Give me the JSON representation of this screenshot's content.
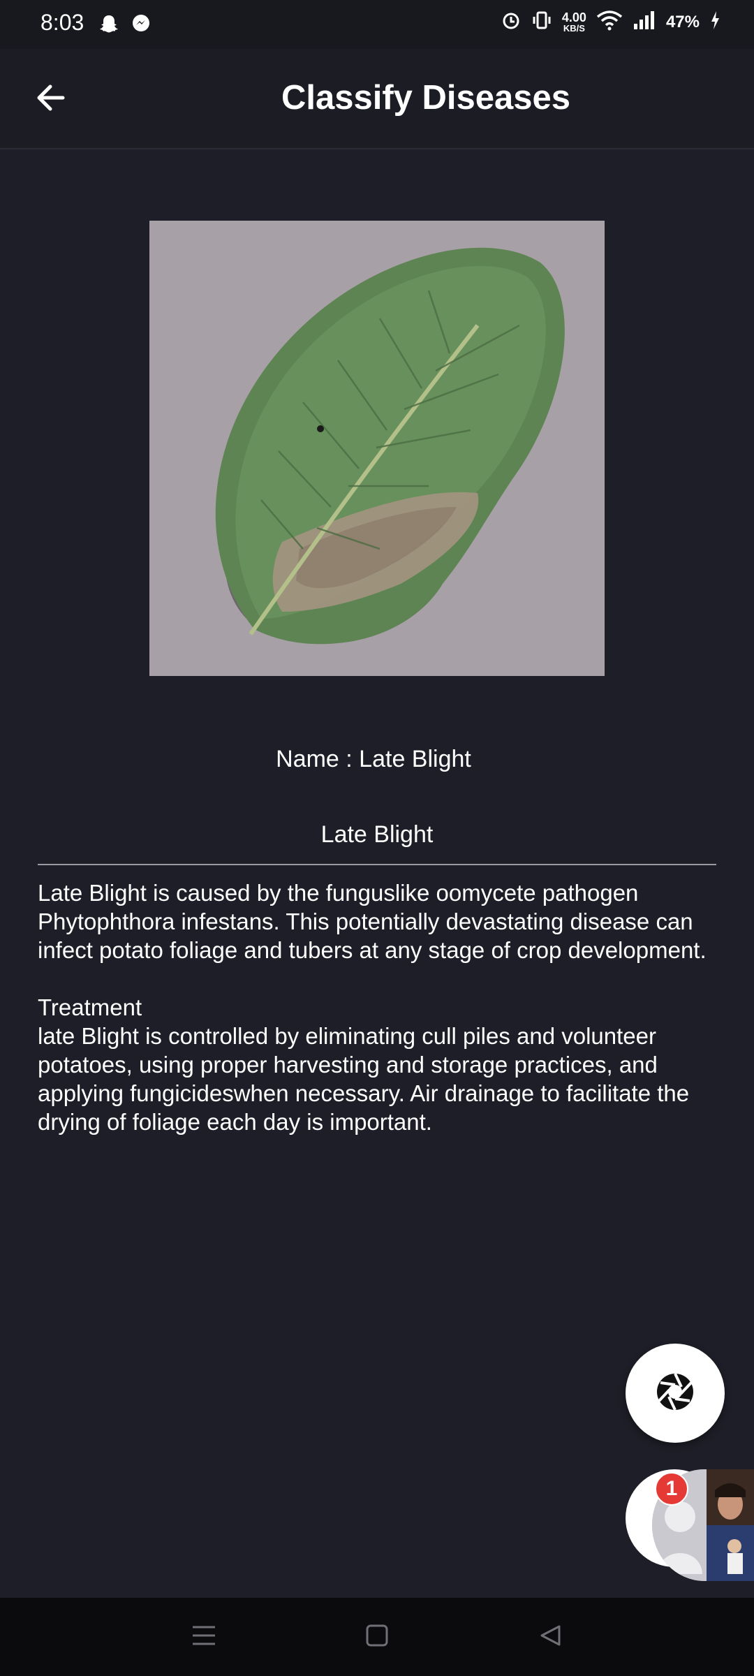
{
  "status_bar": {
    "time": "8:03",
    "net_speed_value": "4.00",
    "net_speed_unit": "KB/S",
    "battery": "47%",
    "icons": [
      "snapchat-icon",
      "messenger-icon",
      "alarm-icon",
      "vibrate-icon",
      "wifi-icon",
      "signal-icon",
      "charging-icon"
    ]
  },
  "app_bar": {
    "title": "Classify Diseases",
    "back_icon": "arrow-left-icon"
  },
  "result": {
    "name_line": "Name : Late Blight",
    "heading": "Late Blight",
    "description": "Late Blight is caused by the funguslike oomycete pathogen Phytophthora infestans. This potentially devastating disease can infect potato foliage and tubers at any stage of crop development.",
    "treatment_label": "Treatment",
    "treatment_text": "late Blight is controlled by eliminating cull piles and volunteer potatoes, using proper harvesting and storage practices, and applying fungicideswhen necessary. Air drainage to facilitate the drying of foliage each day is important."
  },
  "fab": {
    "icon": "camera-shutter-icon"
  },
  "chat_head": {
    "badge_count": "1"
  },
  "nav_bar": {
    "icons": [
      "recents-icon",
      "home-icon",
      "back-icon"
    ]
  },
  "colors": {
    "background": "#1e1e28",
    "app_bar": "#1c1c25",
    "badge": "#e53935"
  }
}
